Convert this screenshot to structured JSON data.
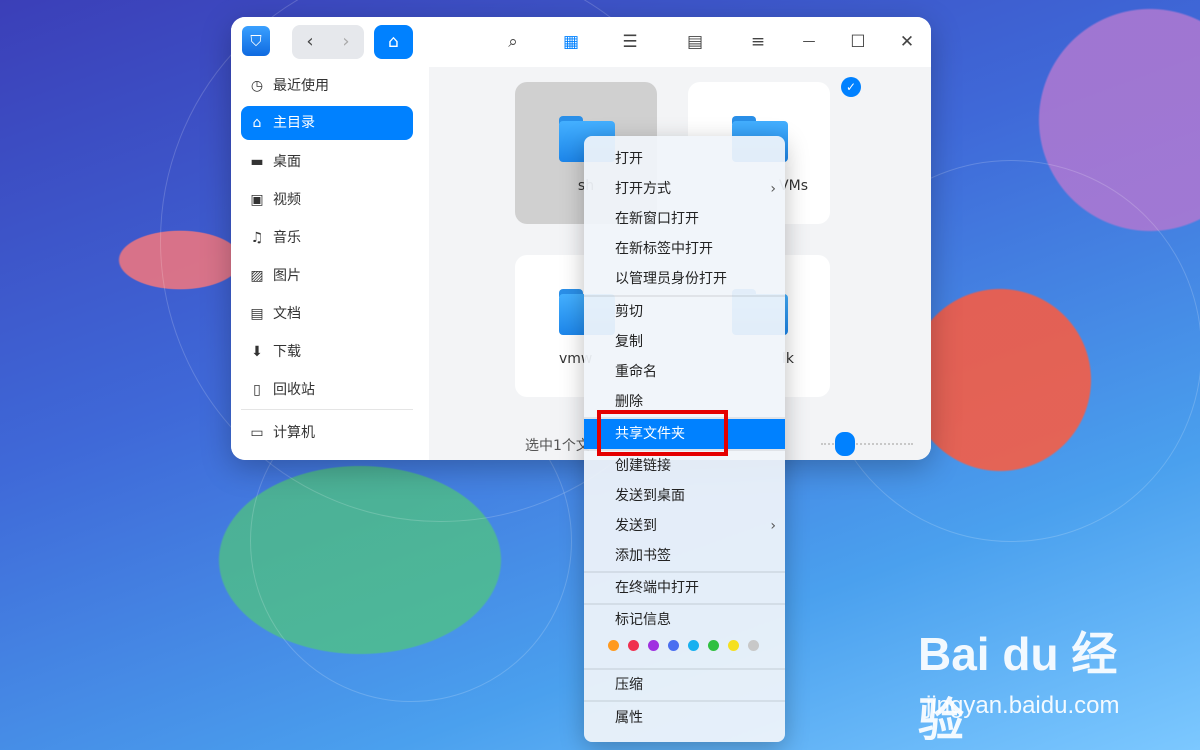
{
  "toolbar": {
    "back_icon": "‹",
    "forward_icon": "›",
    "home_icon": "⌂",
    "search_icon": "⌕",
    "icon_view_icon": "▦",
    "list_view_icon": "☰",
    "detail_view_icon": "▤",
    "menu_icon": "≡",
    "minimize_icon": "—",
    "maximize_icon": "☐",
    "close_icon": "✕"
  },
  "sidebar": {
    "items": [
      {
        "label": "最近使用",
        "icon": "◷"
      },
      {
        "label": "主目录",
        "icon": "⌂"
      },
      {
        "label": "桌面",
        "icon": "▬"
      },
      {
        "label": "视频",
        "icon": "▣"
      },
      {
        "label": "音乐",
        "icon": "♫"
      },
      {
        "label": "图片",
        "icon": "▨"
      },
      {
        "label": "文档",
        "icon": "▤"
      },
      {
        "label": "下载",
        "icon": "⬇"
      },
      {
        "label": "回收站",
        "icon": "▯"
      },
      {
        "label": "计算机",
        "icon": "▭"
      }
    ]
  },
  "content": {
    "tiles": [
      {
        "name": "sh"
      },
      {
        "name": "VMs"
      },
      {
        "name": "vmw"
      },
      {
        "name": "lk"
      }
    ],
    "selected_check": "✓",
    "status": "选中1个文"
  },
  "context_menu": {
    "items": [
      {
        "label": "打开"
      },
      {
        "label": "打开方式",
        "arrow": "›"
      },
      {
        "label": "在新窗口打开"
      },
      {
        "label": "在新标签中打开"
      },
      {
        "label": "以管理员身份打开"
      },
      {
        "label": "剪切"
      },
      {
        "label": "复制"
      },
      {
        "label": "重命名"
      },
      {
        "label": "删除"
      },
      {
        "label": "共享文件夹"
      },
      {
        "label": "创建链接"
      },
      {
        "label": "发送到桌面"
      },
      {
        "label": "发送到",
        "arrow": "›"
      },
      {
        "label": "添加书签"
      },
      {
        "label": "在终端中打开"
      },
      {
        "label": "标记信息"
      },
      {
        "label": "压缩"
      },
      {
        "label": "属性"
      }
    ],
    "tag_colors": [
      "#ff9a1f",
      "#f0304f",
      "#a030e0",
      "#4a6ef0",
      "#17b0f0",
      "#30c040",
      "#f5e020",
      "#c8c8c8"
    ],
    "highlight_color": "#0081ff"
  },
  "watermark": {
    "brand": "Bai du 经验",
    "url": "jingyan.baidu.com"
  }
}
